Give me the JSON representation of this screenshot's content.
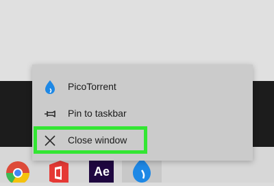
{
  "jump_list": {
    "app_label": "PicoTorrent",
    "pin_label": "Pin to taskbar",
    "close_label": "Close window"
  },
  "taskbar": {
    "apps": [
      "chrome-icon",
      "office-icon",
      "after-effects-icon",
      "picotorrent-icon"
    ],
    "ae_text": "Ae"
  },
  "colors": {
    "highlight": "#33e633",
    "menu_bg": "#cbcbcb",
    "dark_band": "#1c1c1c",
    "pico_blue": "#1e88e5"
  }
}
